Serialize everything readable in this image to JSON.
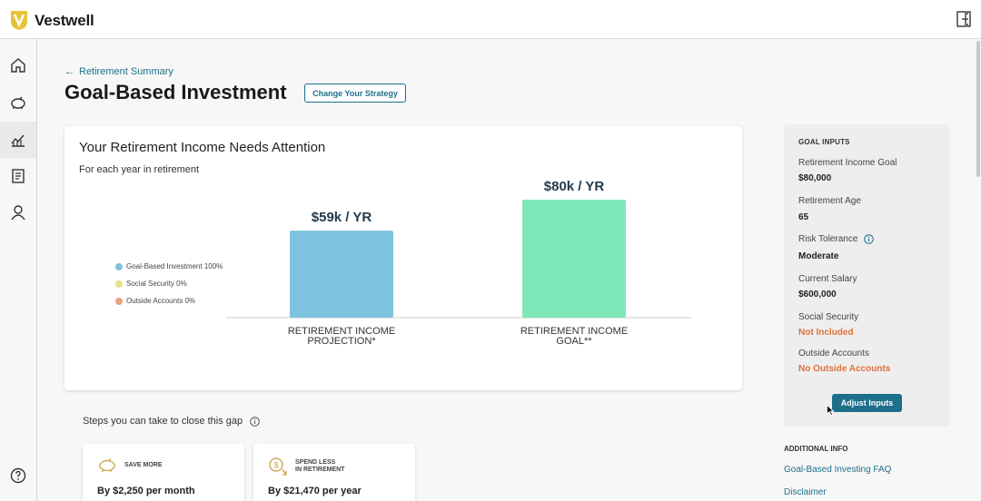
{
  "app": {
    "brand": "Vestwell"
  },
  "colors": {
    "accent": "#1d6f8c",
    "warning": "#e0703a",
    "projection_bar": "#7ec3e0",
    "goal_bar": "#7ee8b8"
  },
  "nav": {
    "back_label": "Retirement Summary"
  },
  "page": {
    "title": "Goal-Based Investment",
    "strategy_button": "Change Your Strategy"
  },
  "card": {
    "title": "Your Retirement Income Needs Attention",
    "subtitle": "For each year in retirement",
    "legend": [
      {
        "label": "Goal-Based Investment 100%",
        "color": "#7ec3e0"
      },
      {
        "label": "Social Security 0%",
        "color": "#e8e08a"
      },
      {
        "label": "Outside Accounts 0%",
        "color": "#e9a07c"
      }
    ]
  },
  "chart_data": {
    "type": "bar",
    "categories": [
      "RETIREMENT INCOME PROJECTION*",
      "RETIREMENT INCOME GOAL**"
    ],
    "category_lines": [
      [
        "RETIREMENT INCOME",
        "PROJECTION*"
      ],
      [
        "RETIREMENT INCOME",
        "GOAL**"
      ]
    ],
    "values": [
      59,
      80
    ],
    "value_labels": [
      "$59k / YR",
      "$80k / YR"
    ],
    "colors": [
      "#7ec3e0",
      "#7ee8b8"
    ]
  },
  "goal_inputs": {
    "heading": "GOAL INPUTS",
    "items": [
      {
        "label": "Retirement Income Goal",
        "value": "$80,000"
      },
      {
        "label": "Retirement Age",
        "value": "65"
      },
      {
        "label": "Risk Tolerance",
        "value": "Moderate"
      },
      {
        "label": "Current Salary",
        "value": "$600,000"
      },
      {
        "label": "Social Security",
        "value": "Not Included"
      },
      {
        "label": "Outside Accounts",
        "value": "No Outside Accounts"
      }
    ],
    "adjust_button": "Adjust Inputs"
  },
  "additional_info": {
    "heading": "ADDITIONAL INFO",
    "links": [
      "Goal-Based Investing FAQ",
      "Disclaimer"
    ]
  },
  "steps": {
    "title": "Steps you can take to close this gap",
    "cards": [
      {
        "label": "SAVE MORE",
        "value": "By $2,250 per month"
      },
      {
        "label_line1": "SPEND LESS",
        "label_line2": "IN RETIREMENT",
        "value": "By $21,470 per year"
      }
    ]
  }
}
